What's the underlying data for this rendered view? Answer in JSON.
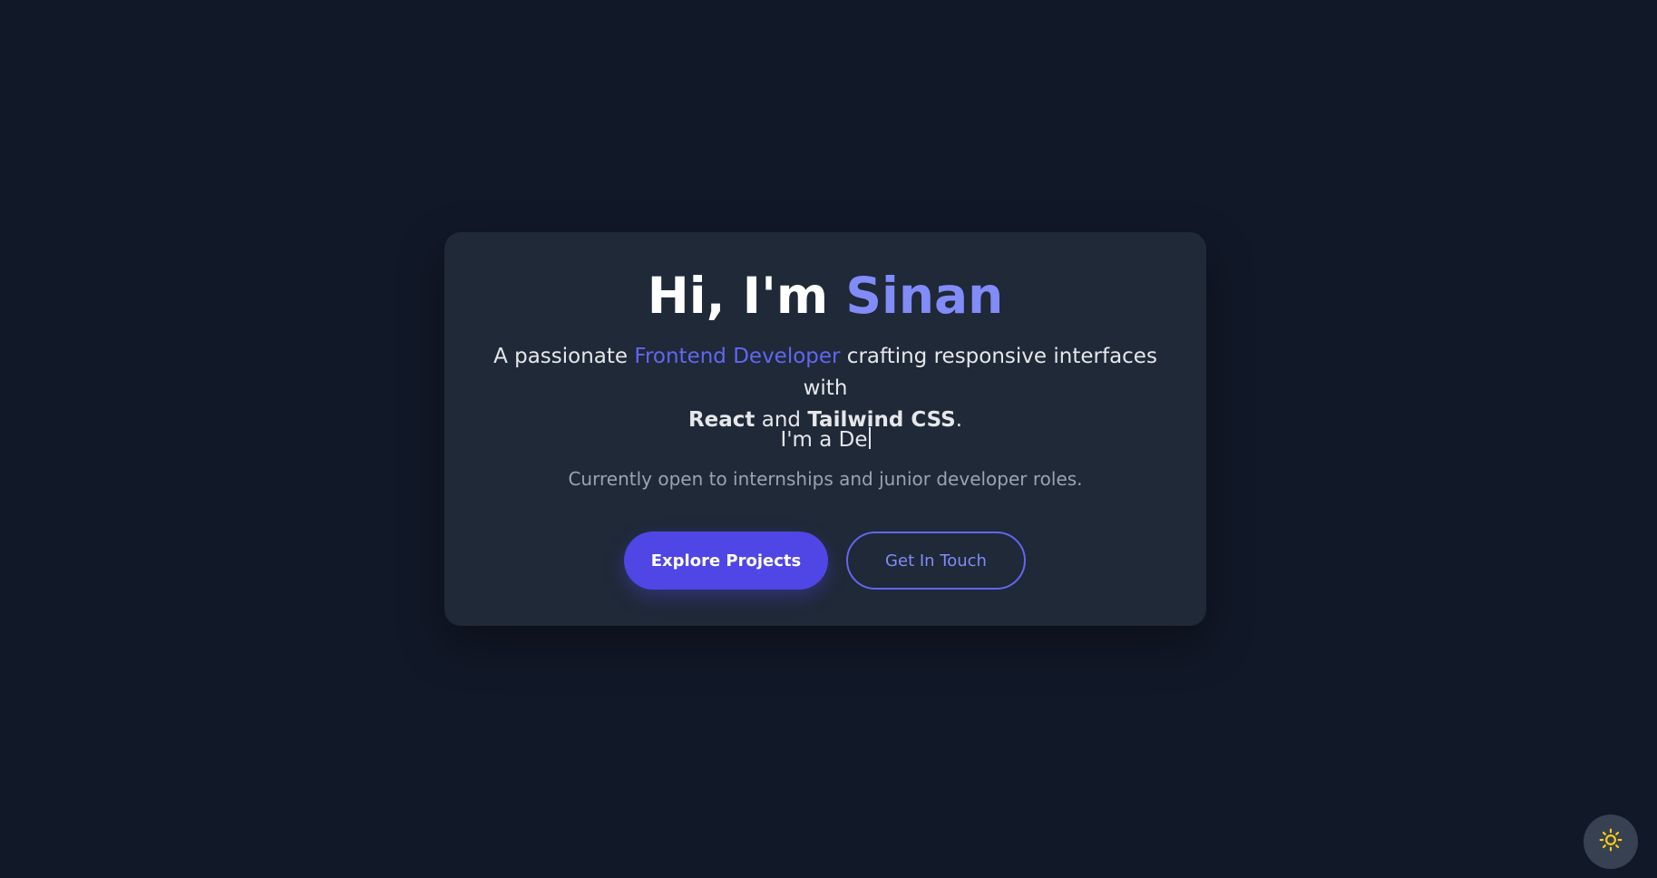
{
  "hero": {
    "greeting": "Hi, I'm ",
    "name": "Sinan",
    "tagline": {
      "prefix": "A passionate ",
      "role": "Frontend Developer",
      "middle": " crafting responsive interfaces with ",
      "tech1": "React",
      "and": " and ",
      "tech2": "Tailwind CSS",
      "suffix": "."
    },
    "typing_text": "I'm a De",
    "status": "Currently open to internships and junior developer roles."
  },
  "actions": {
    "primary_label": "Explore Projects",
    "secondary_label": "Get In Touch"
  },
  "theme_toggle": {
    "icon": "sun-icon",
    "icon_color": "#facc15"
  },
  "colors": {
    "background": "#111827",
    "card": "#1f2937",
    "accent": "#6366f1",
    "accent_light": "#818cf8",
    "button": "#4f46e5"
  }
}
